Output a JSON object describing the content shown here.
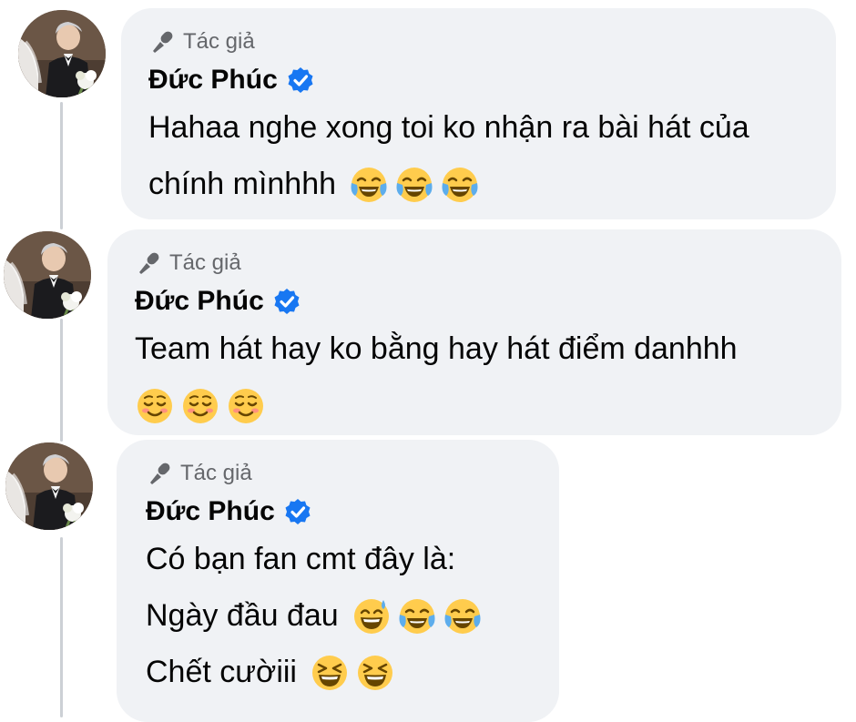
{
  "comments": [
    {
      "badge": "Tác giả",
      "author": "Đức Phúc",
      "lines": [
        "Hahaa nghe xong toi ko nhận ra bài hát của",
        "chính mìnhhh"
      ],
      "emojis": [
        "face-with-tears-of-joy",
        "face-with-tears-of-joy",
        "face-with-tears-of-joy"
      ]
    },
    {
      "badge": "Tác giả",
      "author": "Đức Phúc",
      "lines": [
        "Team hát hay ko bằng hay hát điểm danhhh"
      ],
      "emojis": [
        "smiling-face",
        "smiling-face",
        "smiling-face"
      ]
    },
    {
      "badge": "Tác giả",
      "author": "Đức Phúc",
      "lines": [
        "Có bạn fan cmt đây là:",
        "Ngày đầu đau",
        "Chết cườiii"
      ],
      "emojis_line2": [
        "grinning-face-with-sweat",
        "face-with-tears-of-joy",
        "face-with-tears-of-joy"
      ],
      "emojis_line3": [
        "grinning-squinting-face",
        "grinning-squinting-face"
      ]
    }
  ],
  "colors": {
    "bubble": "#f0f2f5",
    "badge_text": "#65676b",
    "verified": "#1877f2",
    "thread_line": "#ccd0d5"
  }
}
